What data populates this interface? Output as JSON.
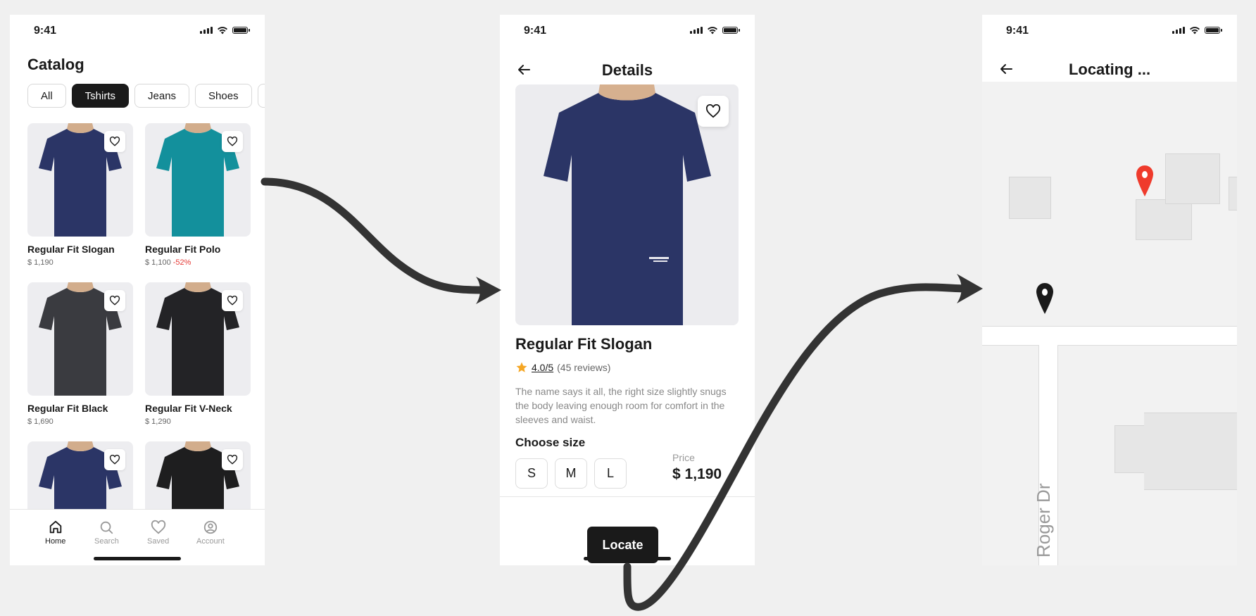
{
  "status": {
    "time": "9:41"
  },
  "catalog": {
    "title": "Catalog",
    "chips": [
      "All",
      "Tshirts",
      "Jeans",
      "Shoes"
    ],
    "active_chip": "Tshirts",
    "products": [
      {
        "name": "Regular Fit Slogan",
        "price": "$ 1,190",
        "discount": "",
        "color": "#2b3566"
      },
      {
        "name": "Regular Fit Polo",
        "price": "$ 1,100",
        "discount": "-52%",
        "color": "#13909c"
      },
      {
        "name": "Regular Fit Black",
        "price": "$ 1,690",
        "discount": "",
        "color": "#3a3b40"
      },
      {
        "name": "Regular Fit V-Neck",
        "price": "$ 1,290",
        "discount": "",
        "color": "#232326"
      },
      {
        "name": "",
        "price": "",
        "discount": "",
        "color": "#2b3566"
      },
      {
        "name": "",
        "price": "",
        "discount": "",
        "color": "#1e1e1f"
      }
    ],
    "nav": [
      {
        "label": "Home",
        "icon": "home-icon",
        "active": true
      },
      {
        "label": "Search",
        "icon": "search-icon",
        "active": false
      },
      {
        "label": "Saved",
        "icon": "heart-icon",
        "active": false
      },
      {
        "label": "Account",
        "icon": "account-icon",
        "active": false
      }
    ]
  },
  "details": {
    "title": "Details",
    "product_name": "Regular Fit Slogan",
    "rating": "4.0/5",
    "reviews": "(45 reviews)",
    "description": "The name says it all, the right size slightly snugs the body leaving enough room for comfort in the sleeves and waist.",
    "choose_size": "Choose size",
    "sizes": [
      "S",
      "M",
      "L"
    ],
    "price_label": "Price",
    "price": "$ 1,190",
    "button": "Locate",
    "star_color": "#f5a623"
  },
  "locating": {
    "title": "Locating ...",
    "street": "Roger Dr",
    "pin_color_dest": "#ef3b2c",
    "pin_color_user": "#1a1a1a"
  }
}
